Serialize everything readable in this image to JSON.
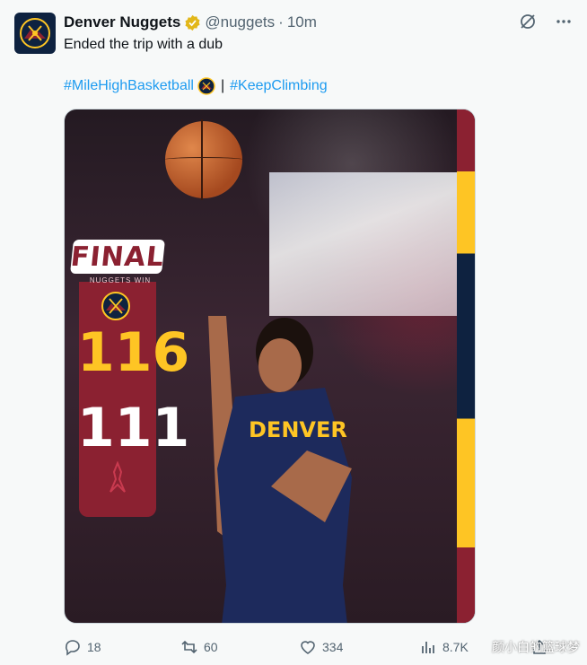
{
  "account": {
    "name": "Denver Nuggets",
    "handle": "@nuggets",
    "separator": "·",
    "time": "10m",
    "avatar_icon": "denver-nuggets-logo-icon",
    "verified_icon": "gold-verified-badge-icon"
  },
  "tweet": {
    "text": "Ended the trip with a dub",
    "hashtags": [
      "#MileHighBasketball",
      "#KeepClimbing"
    ],
    "separator": "|"
  },
  "media": {
    "final_label": "FINAL",
    "final_sub": "NUGGETS WIN",
    "nuggets_score": "116",
    "opponent_score": "111",
    "jersey_text": "DENVER",
    "colors": {
      "maroon": "#8b2131",
      "gold": "#fec524",
      "navy": "#0e2240"
    }
  },
  "actions": {
    "replies": "18",
    "retweets": "60",
    "likes": "334",
    "views": "8.7K"
  },
  "watermark": "颜小白的篮球梦",
  "colors": {
    "link": "#1d9bf0",
    "muted": "#536471",
    "text": "#0f1419"
  }
}
